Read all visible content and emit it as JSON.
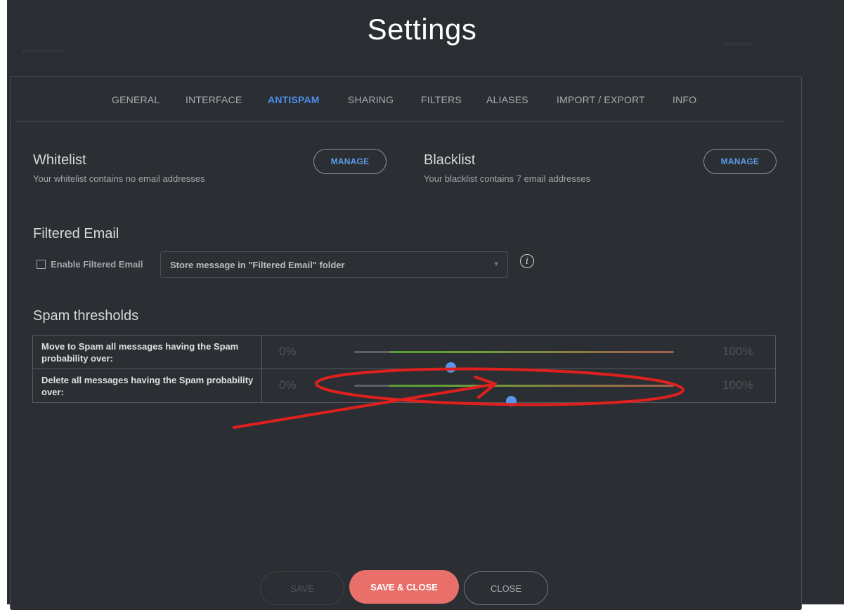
{
  "dialog": {
    "title": "Settings"
  },
  "tabs": [
    {
      "label": "GENERAL",
      "active": false
    },
    {
      "label": "INTERFACE",
      "active": false
    },
    {
      "label": "ANTISPAM",
      "active": true
    },
    {
      "label": "SHARING",
      "active": false
    },
    {
      "label": "FILTERS",
      "active": false
    },
    {
      "label": "ALIASES",
      "active": false
    },
    {
      "label": "IMPORT / EXPORT",
      "active": false
    },
    {
      "label": "INFO",
      "active": false
    }
  ],
  "whitelist": {
    "title": "Whitelist",
    "subtitle": "Your whitelist contains no email addresses",
    "button_label": "MANAGE"
  },
  "blacklist": {
    "title": "Blacklist",
    "subtitle": "Your blacklist contains 7 email addresses",
    "button_label": "MANAGE"
  },
  "filtered_email": {
    "title": "Filtered Email",
    "checkbox_label": "Enable Filtered Email",
    "checked": false,
    "select_value": "Store message in \"Filtered Email\" folder",
    "info_icon": "info-icon"
  },
  "spam_thresholds": {
    "title": "Spam thresholds",
    "rows": [
      {
        "label": "Move to Spam all messages having the Spam probability over:",
        "min_label": "0%",
        "max_label": "100%",
        "value_percent": 30
      },
      {
        "label": "Delete all messages having the Spam probability over:",
        "min_label": "0%",
        "max_label": "100%",
        "value_percent": 49
      }
    ]
  },
  "footer": {
    "save_label": "SAVE",
    "save_close_label": "SAVE & CLOSE",
    "close_label": "CLOSE"
  },
  "colors": {
    "accent": "#4d8ee8",
    "primary_button": "#e9706a",
    "background": "#2a2e32",
    "annotation": "#e0201e"
  }
}
